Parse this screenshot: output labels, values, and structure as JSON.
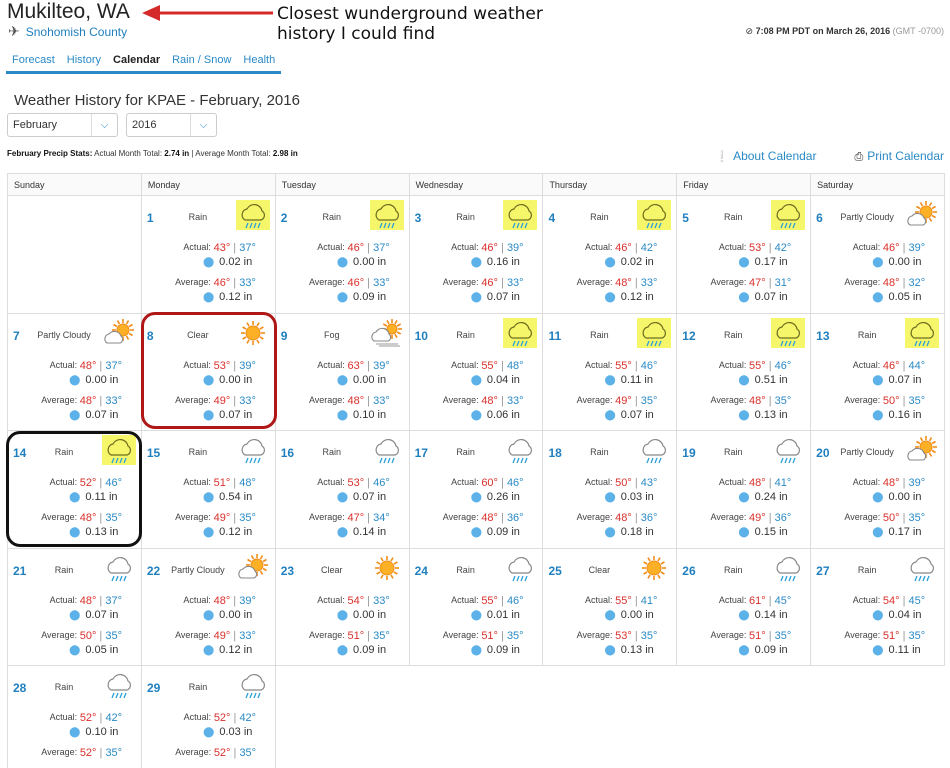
{
  "header": {
    "city": "Mukilteo, WA",
    "county": "Snohomish County",
    "annotation": "Closest wunderground weather history I could find",
    "annotation_line1": "Closest wunderground weather",
    "annotation_line2": "history I could find",
    "timestamp": "7:08 PM PDT on March 26, 2016",
    "gmt": "(GMT -0700)"
  },
  "tabs": [
    {
      "label": "Forecast"
    },
    {
      "label": "History"
    },
    {
      "label": "Calendar",
      "active": true
    },
    {
      "label": "Rain / Snow"
    },
    {
      "label": "Health"
    }
  ],
  "page_title": "Weather History for KPAE - February, 2016",
  "month_select": "February",
  "year_select": "2016",
  "precip_stats": {
    "label": "February Precip Stats:",
    "actual_label": "Actual Month Total:",
    "actual_value": "2.74 in",
    "average_label": "Average Month Total:",
    "average_value": "2.98 in"
  },
  "links": {
    "about": "About Calendar",
    "print": "Print Calendar"
  },
  "labels": {
    "actual": "Actual:",
    "average": "Average:"
  },
  "days_of_week": [
    "Sunday",
    "Monday",
    "Tuesday",
    "Wednesday",
    "Thursday",
    "Friday",
    "Saturday"
  ],
  "days": [
    null,
    {
      "day": "1",
      "cond": "Rain",
      "icon": "rain-cloud-icon",
      "hl": true,
      "act_hi": "43°",
      "act_lo": "37°",
      "act_rain": "0.02 in",
      "avg_hi": "46°",
      "avg_lo": "33°",
      "avg_rain": "0.12 in"
    },
    {
      "day": "2",
      "cond": "Rain",
      "icon": "rain-cloud-icon",
      "hl": true,
      "act_hi": "46°",
      "act_lo": "37°",
      "act_rain": "0.00 in",
      "avg_hi": "46°",
      "avg_lo": "33°",
      "avg_rain": "0.09 in"
    },
    {
      "day": "3",
      "cond": "Rain",
      "icon": "rain-cloud-icon",
      "hl": true,
      "act_hi": "46°",
      "act_lo": "39°",
      "act_rain": "0.16 in",
      "avg_hi": "46°",
      "avg_lo": "33°",
      "avg_rain": "0.07 in"
    },
    {
      "day": "4",
      "cond": "Rain",
      "icon": "rain-cloud-icon",
      "hl": true,
      "act_hi": "46°",
      "act_lo": "42°",
      "act_rain": "0.02 in",
      "avg_hi": "48°",
      "avg_lo": "33°",
      "avg_rain": "0.12 in"
    },
    {
      "day": "5",
      "cond": "Rain",
      "icon": "rain-cloud-icon",
      "hl": true,
      "act_hi": "53°",
      "act_lo": "42°",
      "act_rain": "0.17 in",
      "avg_hi": "47°",
      "avg_lo": "31°",
      "avg_rain": "0.07 in"
    },
    {
      "day": "6",
      "cond": "Partly Cloudy",
      "icon": "partly-cloudy-icon",
      "hl": false,
      "act_hi": "46°",
      "act_lo": "39°",
      "act_rain": "0.00 in",
      "avg_hi": "48°",
      "avg_lo": "32°",
      "avg_rain": "0.05 in"
    },
    {
      "day": "7",
      "cond": "Partly Cloudy",
      "icon": "partly-cloudy-icon",
      "hl": false,
      "act_hi": "48°",
      "act_lo": "37°",
      "act_rain": "0.00 in",
      "avg_hi": "48°",
      "avg_lo": "33°",
      "avg_rain": "0.07 in"
    },
    {
      "day": "8",
      "cond": "Clear",
      "icon": "sun-icon",
      "hl": false,
      "act_hi": "53°",
      "act_lo": "39°",
      "act_rain": "0.00 in",
      "avg_hi": "49°",
      "avg_lo": "33°",
      "avg_rain": "0.07 in"
    },
    {
      "day": "9",
      "cond": "Fog",
      "icon": "fog-icon",
      "hl": false,
      "act_hi": "63°",
      "act_lo": "39°",
      "act_rain": "0.00 in",
      "avg_hi": "48°",
      "avg_lo": "33°",
      "avg_rain": "0.10 in"
    },
    {
      "day": "10",
      "cond": "Rain",
      "icon": "rain-cloud-icon",
      "hl": true,
      "act_hi": "55°",
      "act_lo": "48°",
      "act_rain": "0.04 in",
      "avg_hi": "48°",
      "avg_lo": "33°",
      "avg_rain": "0.06 in"
    },
    {
      "day": "11",
      "cond": "Rain",
      "icon": "rain-cloud-icon",
      "hl": true,
      "act_hi": "55°",
      "act_lo": "46°",
      "act_rain": "0.11 in",
      "avg_hi": "49°",
      "avg_lo": "35°",
      "avg_rain": "0.07 in"
    },
    {
      "day": "12",
      "cond": "Rain",
      "icon": "rain-cloud-icon",
      "hl": true,
      "act_hi": "55°",
      "act_lo": "46°",
      "act_rain": "0.51 in",
      "avg_hi": "48°",
      "avg_lo": "35°",
      "avg_rain": "0.13 in"
    },
    {
      "day": "13",
      "cond": "Rain",
      "icon": "rain-cloud-icon",
      "hl": true,
      "act_hi": "46°",
      "act_lo": "44°",
      "act_rain": "0.07 in",
      "avg_hi": "50°",
      "avg_lo": "35°",
      "avg_rain": "0.16 in"
    },
    {
      "day": "14",
      "cond": "Rain",
      "icon": "rain-cloud-icon",
      "hl": true,
      "act_hi": "52°",
      "act_lo": "46°",
      "act_rain": "0.11 in",
      "avg_hi": "48°",
      "avg_lo": "35°",
      "avg_rain": "0.13 in"
    },
    {
      "day": "15",
      "cond": "Rain",
      "icon": "rain-cloud-icon",
      "hl": false,
      "act_hi": "51°",
      "act_lo": "48°",
      "act_rain": "0.54 in",
      "avg_hi": "49°",
      "avg_lo": "35°",
      "avg_rain": "0.12 in"
    },
    {
      "day": "16",
      "cond": "Rain",
      "icon": "rain-cloud-icon",
      "hl": false,
      "act_hi": "53°",
      "act_lo": "46°",
      "act_rain": "0.07 in",
      "avg_hi": "47°",
      "avg_lo": "34°",
      "avg_rain": "0.14 in"
    },
    {
      "day": "17",
      "cond": "Rain",
      "icon": "rain-cloud-icon",
      "hl": false,
      "act_hi": "60°",
      "act_lo": "46°",
      "act_rain": "0.26 in",
      "avg_hi": "48°",
      "avg_lo": "36°",
      "avg_rain": "0.09 in"
    },
    {
      "day": "18",
      "cond": "Rain",
      "icon": "rain-cloud-icon",
      "hl": false,
      "act_hi": "50°",
      "act_lo": "43°",
      "act_rain": "0.03 in",
      "avg_hi": "48°",
      "avg_lo": "36°",
      "avg_rain": "0.18 in"
    },
    {
      "day": "19",
      "cond": "Rain",
      "icon": "rain-cloud-icon",
      "hl": false,
      "act_hi": "48°",
      "act_lo": "41°",
      "act_rain": "0.24 in",
      "avg_hi": "49°",
      "avg_lo": "36°",
      "avg_rain": "0.15 in"
    },
    {
      "day": "20",
      "cond": "Partly Cloudy",
      "icon": "partly-cloudy-icon",
      "hl": false,
      "act_hi": "48°",
      "act_lo": "39°",
      "act_rain": "0.00 in",
      "avg_hi": "50°",
      "avg_lo": "35°",
      "avg_rain": "0.17 in"
    },
    {
      "day": "21",
      "cond": "Rain",
      "icon": "rain-cloud-icon",
      "hl": false,
      "act_hi": "48°",
      "act_lo": "37°",
      "act_rain": "0.07 in",
      "avg_hi": "50°",
      "avg_lo": "35°",
      "avg_rain": "0.05 in"
    },
    {
      "day": "22",
      "cond": "Partly Cloudy",
      "icon": "partly-cloudy-icon",
      "hl": false,
      "act_hi": "48°",
      "act_lo": "39°",
      "act_rain": "0.00 in",
      "avg_hi": "49°",
      "avg_lo": "33°",
      "avg_rain": "0.12 in"
    },
    {
      "day": "23",
      "cond": "Clear",
      "icon": "sun-icon",
      "hl": false,
      "act_hi": "54°",
      "act_lo": "33°",
      "act_rain": "0.00 in",
      "avg_hi": "51°",
      "avg_lo": "35°",
      "avg_rain": "0.09 in"
    },
    {
      "day": "24",
      "cond": "Rain",
      "icon": "rain-cloud-icon",
      "hl": false,
      "act_hi": "55°",
      "act_lo": "46°",
      "act_rain": "0.01 in",
      "avg_hi": "51°",
      "avg_lo": "35°",
      "avg_rain": "0.09 in"
    },
    {
      "day": "25",
      "cond": "Clear",
      "icon": "sun-icon",
      "hl": false,
      "act_hi": "55°",
      "act_lo": "41°",
      "act_rain": "0.00 in",
      "avg_hi": "53°",
      "avg_lo": "35°",
      "avg_rain": "0.13 in"
    },
    {
      "day": "26",
      "cond": "Rain",
      "icon": "rain-cloud-icon",
      "hl": false,
      "act_hi": "61°",
      "act_lo": "45°",
      "act_rain": "0.14 in",
      "avg_hi": "51°",
      "avg_lo": "35°",
      "avg_rain": "0.09 in"
    },
    {
      "day": "27",
      "cond": "Rain",
      "icon": "rain-cloud-icon",
      "hl": false,
      "act_hi": "54°",
      "act_lo": "45°",
      "act_rain": "0.04 in",
      "avg_hi": "51°",
      "avg_lo": "35°",
      "avg_rain": "0.11 in"
    },
    {
      "day": "28",
      "cond": "Rain",
      "icon": "rain-cloud-icon",
      "hl": false,
      "act_hi": "52°",
      "act_lo": "42°",
      "act_rain": "0.10 in",
      "avg_hi": "52°",
      "avg_lo": "35°",
      "avg_rain": ""
    },
    {
      "day": "29",
      "cond": "Rain",
      "icon": "rain-cloud-icon",
      "hl": false,
      "act_hi": "52°",
      "act_lo": "42°",
      "act_rain": "0.03 in",
      "avg_hi": "52°",
      "avg_lo": "35°",
      "avg_rain": ""
    }
  ],
  "colors": {
    "link": "#2a8ac6",
    "hi": "#d9302b",
    "lo": "#2a8ac6",
    "highlight": "#f6f66a",
    "annotation_red": "#b01818"
  }
}
